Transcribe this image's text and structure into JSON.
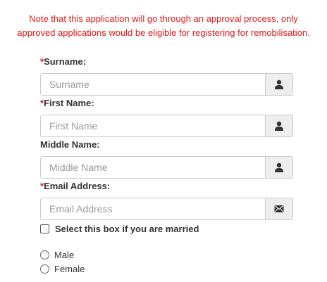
{
  "note": {
    "line1": "Note that this application will go through an approval process, only",
    "line2": "approved applications would be eligible for registering for remobilisation."
  },
  "required_marker": "*",
  "fields": [
    {
      "label": "Surname:",
      "placeholder": "Surname",
      "required": true,
      "icon": "user-icon"
    },
    {
      "label": "First Name:",
      "placeholder": "First Name",
      "required": true,
      "icon": "user-icon"
    },
    {
      "label": "Middle Name:",
      "placeholder": "Middle Name",
      "required": false,
      "icon": "user-icon"
    },
    {
      "label": "Email Address:",
      "placeholder": "Email Address",
      "required": true,
      "icon": "envelope-icon"
    }
  ],
  "married_checkbox": {
    "label": "Select this box if you are married",
    "checked": false
  },
  "gender_options": [
    {
      "label": "Male",
      "selected": false
    },
    {
      "label": "Female",
      "selected": false
    }
  ],
  "colors": {
    "accent_red": "#e0181b",
    "addon_bg": "#eeeeee",
    "icon": "#333333"
  }
}
